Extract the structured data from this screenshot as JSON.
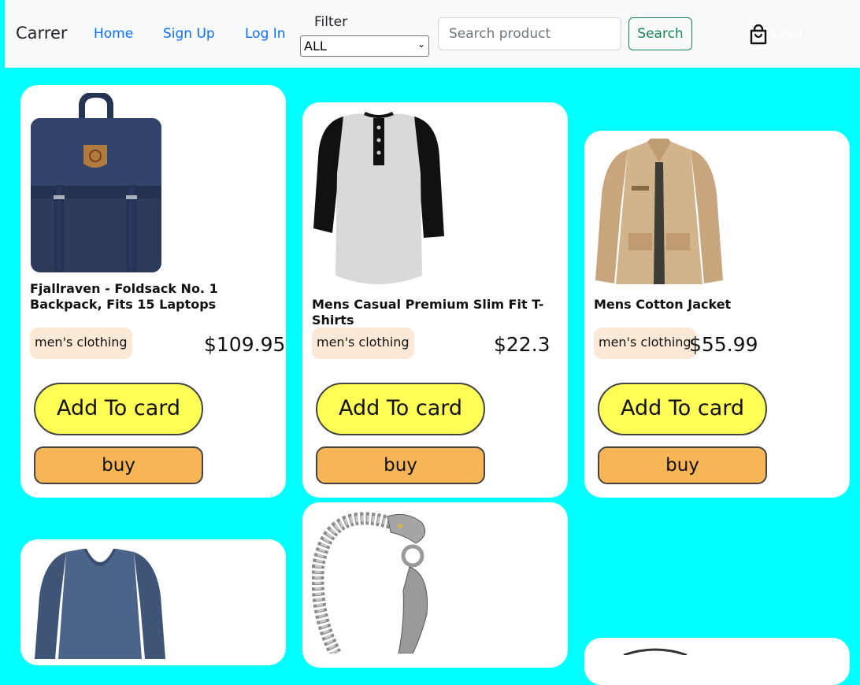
{
  "nav": {
    "brand": "Carrer",
    "links": [
      "Home",
      "Sign Up",
      "Log In"
    ],
    "filter_label": "Filter",
    "filter_selected": "ALL",
    "search_placeholder": "Search product",
    "search_button": "Search",
    "cart_label": "Card",
    "cart_icon": "shopping-bag-icon"
  },
  "colors": {
    "page_background": "#00ffff",
    "add_button": "#ffff55",
    "buy_button": "#f8b556",
    "category_badge": "#fbe9d6",
    "search_button": "#198754",
    "nav_link": "#0d6efd"
  },
  "products": [
    {
      "title": "Fjallraven - Foldsack No. 1 Backpack, Fits 15 Laptops",
      "category": "men's clothing",
      "price": "$109.95",
      "add_label": "Add To card",
      "buy_label": "buy",
      "image": "backpack"
    },
    {
      "title": "Mens Casual Premium Slim Fit T-Shirts",
      "category": "men's clothing",
      "price": "$22.3",
      "add_label": "Add To card",
      "buy_label": "buy",
      "image": "henley-shirt"
    },
    {
      "title": "Mens Cotton Jacket",
      "category": "men's clothing",
      "price": "$55.99",
      "add_label": "Add To card",
      "buy_label": "buy",
      "image": "cotton-jacket"
    },
    {
      "image": "v-neck-sweater"
    },
    {
      "image": "dragon-bracelet"
    },
    {
      "image": "ring"
    }
  ]
}
